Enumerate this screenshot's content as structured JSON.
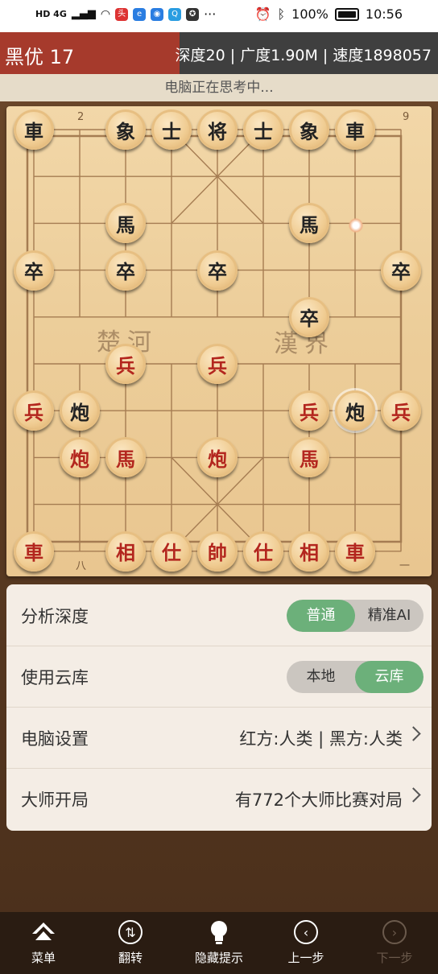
{
  "status_bar": {
    "network": "HD 4G",
    "battery": "100%",
    "time": "10:56"
  },
  "engine": {
    "evaluation": "黑优 17",
    "eval_fraction": 0.41,
    "stats": "深度20 | 广度1.90M | 速度1898057",
    "thinking": "电脑正在思考中..."
  },
  "board": {
    "river_left": "楚河",
    "river_right": "漢界",
    "top_numbers": [
      "2",
      "9"
    ],
    "bottom_numbers": [
      "八",
      "一"
    ],
    "pieces": [
      {
        "label": "車",
        "color": "black"
      },
      {
        "label": "象",
        "color": "black"
      },
      {
        "label": "士",
        "color": "black"
      },
      {
        "label": "将",
        "color": "black"
      },
      {
        "label": "士",
        "color": "black"
      },
      {
        "label": "象",
        "color": "black"
      },
      {
        "label": "車",
        "color": "black"
      },
      {
        "label": "馬",
        "color": "black"
      },
      {
        "label": "馬",
        "color": "black"
      },
      {
        "label": "卒",
        "color": "black"
      },
      {
        "label": "卒",
        "color": "black"
      },
      {
        "label": "卒",
        "color": "black"
      },
      {
        "label": "卒",
        "color": "black"
      },
      {
        "label": "卒",
        "color": "black"
      },
      {
        "label": "兵",
        "color": "red"
      },
      {
        "label": "兵",
        "color": "red"
      },
      {
        "label": "兵",
        "color": "red"
      },
      {
        "label": "炮",
        "color": "black"
      },
      {
        "label": "兵",
        "color": "red"
      },
      {
        "label": "炮",
        "color": "black"
      },
      {
        "label": "兵",
        "color": "red"
      },
      {
        "label": "炮",
        "color": "red"
      },
      {
        "label": "馬",
        "color": "red"
      },
      {
        "label": "炮",
        "color": "red"
      },
      {
        "label": "馬",
        "color": "red"
      },
      {
        "label": "車",
        "color": "red"
      },
      {
        "label": "相",
        "color": "red"
      },
      {
        "label": "仕",
        "color": "red"
      },
      {
        "label": "帥",
        "color": "red"
      },
      {
        "label": "仕",
        "color": "red"
      },
      {
        "label": "相",
        "color": "red"
      },
      {
        "label": "車",
        "color": "red"
      }
    ]
  },
  "settings": {
    "depth": {
      "label": "分析深度",
      "options": [
        "普通",
        "精准AI"
      ],
      "selected": "普通"
    },
    "cloud": {
      "label": "使用云库",
      "options": [
        "本地",
        "云库"
      ],
      "selected": "云库"
    },
    "computer": {
      "label": "电脑设置",
      "value": "红方:人类 | 黑方:人类"
    },
    "master": {
      "label": "大师开局",
      "value": "有772个大师比赛对局"
    }
  },
  "nav": [
    {
      "label": "菜单",
      "icon": "menu-icon",
      "enabled": true
    },
    {
      "label": "翻转",
      "icon": "flip-icon",
      "enabled": true
    },
    {
      "label": "隐藏提示",
      "icon": "bulb-icon",
      "enabled": true
    },
    {
      "label": "上一步",
      "icon": "undo-icon",
      "enabled": true
    },
    {
      "label": "下一步",
      "icon": "redo-icon",
      "enabled": false
    }
  ],
  "colors": {
    "eval_red": "#a63a2c",
    "toggle_green": "#6cb07a",
    "piece_red": "#b3261e"
  }
}
